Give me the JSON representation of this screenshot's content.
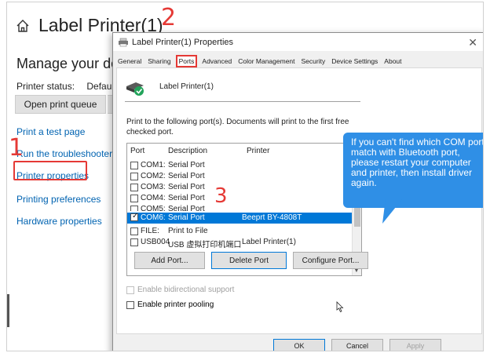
{
  "background": {
    "title": "Label Printer(1)",
    "manage_heading": "Manage your devi",
    "printer_status_label": "Printer status:",
    "printer_status_value": "Default",
    "open_queue_button": "Open print queue",
    "links": [
      {
        "label": "Print a test page"
      },
      {
        "label": "Run the troubleshooter"
      },
      {
        "label": "Printer properties"
      },
      {
        "label": "Printing preferences"
      },
      {
        "label": "Hardware properties"
      }
    ]
  },
  "annotations": {
    "step1": "1",
    "step2": "2",
    "step3": "3",
    "accent_color": "#e53935"
  },
  "dialog": {
    "title": "Label Printer(1) Properties",
    "close_glyph": "✕",
    "tabs": [
      {
        "label": "General",
        "active": false
      },
      {
        "label": "Sharing",
        "active": false
      },
      {
        "label": "Ports",
        "active": true
      },
      {
        "label": "Advanced",
        "active": false
      },
      {
        "label": "Color Management",
        "active": false
      },
      {
        "label": "Security",
        "active": false
      },
      {
        "label": "Device Settings",
        "active": false
      },
      {
        "label": "About",
        "active": false
      }
    ],
    "printer_name": "Label Printer(1)",
    "instruction": "Print to the following port(s). Documents will print to the first free checked port.",
    "columns": {
      "port": "Port",
      "description": "Description",
      "printer": "Printer"
    },
    "ports": [
      {
        "port": "COM1:",
        "description": "Serial Port",
        "printer": "",
        "checked": false
      },
      {
        "port": "COM2:",
        "description": "Serial Port",
        "printer": "",
        "checked": false
      },
      {
        "port": "COM3:",
        "description": "Serial Port",
        "printer": "",
        "checked": false
      },
      {
        "port": "COM4:",
        "description": "Serial Port",
        "printer": "",
        "checked": false
      },
      {
        "port": "COM5:",
        "description": "Serial Port",
        "printer": "",
        "checked": false
      },
      {
        "port": "COM6:",
        "description": "Serial Port",
        "printer": "Beeprt BY-4808T",
        "checked": true
      },
      {
        "port": "FILE:",
        "description": "Print to File",
        "printer": "",
        "checked": false
      },
      {
        "port": "USB004",
        "description": "USB 虚拟打印机端口",
        "printer": "Label Printer(1)",
        "checked": false
      }
    ],
    "buttons": {
      "add_port": "Add Port...",
      "delete_port": "Delete Port",
      "configure_port": "Configure Port..."
    },
    "enable_bidirectional": "Enable bidirectional support",
    "enable_pooling": "Enable printer pooling",
    "footer": {
      "ok": "OK",
      "cancel": "Cancel",
      "apply": "Apply"
    },
    "selection_color": "#0078d7"
  },
  "tooltip": {
    "text": "If you can't find which COM port match with Bluetooth port, please restart your computer and printer, then install driver again.",
    "color": "#2f8fe6"
  }
}
